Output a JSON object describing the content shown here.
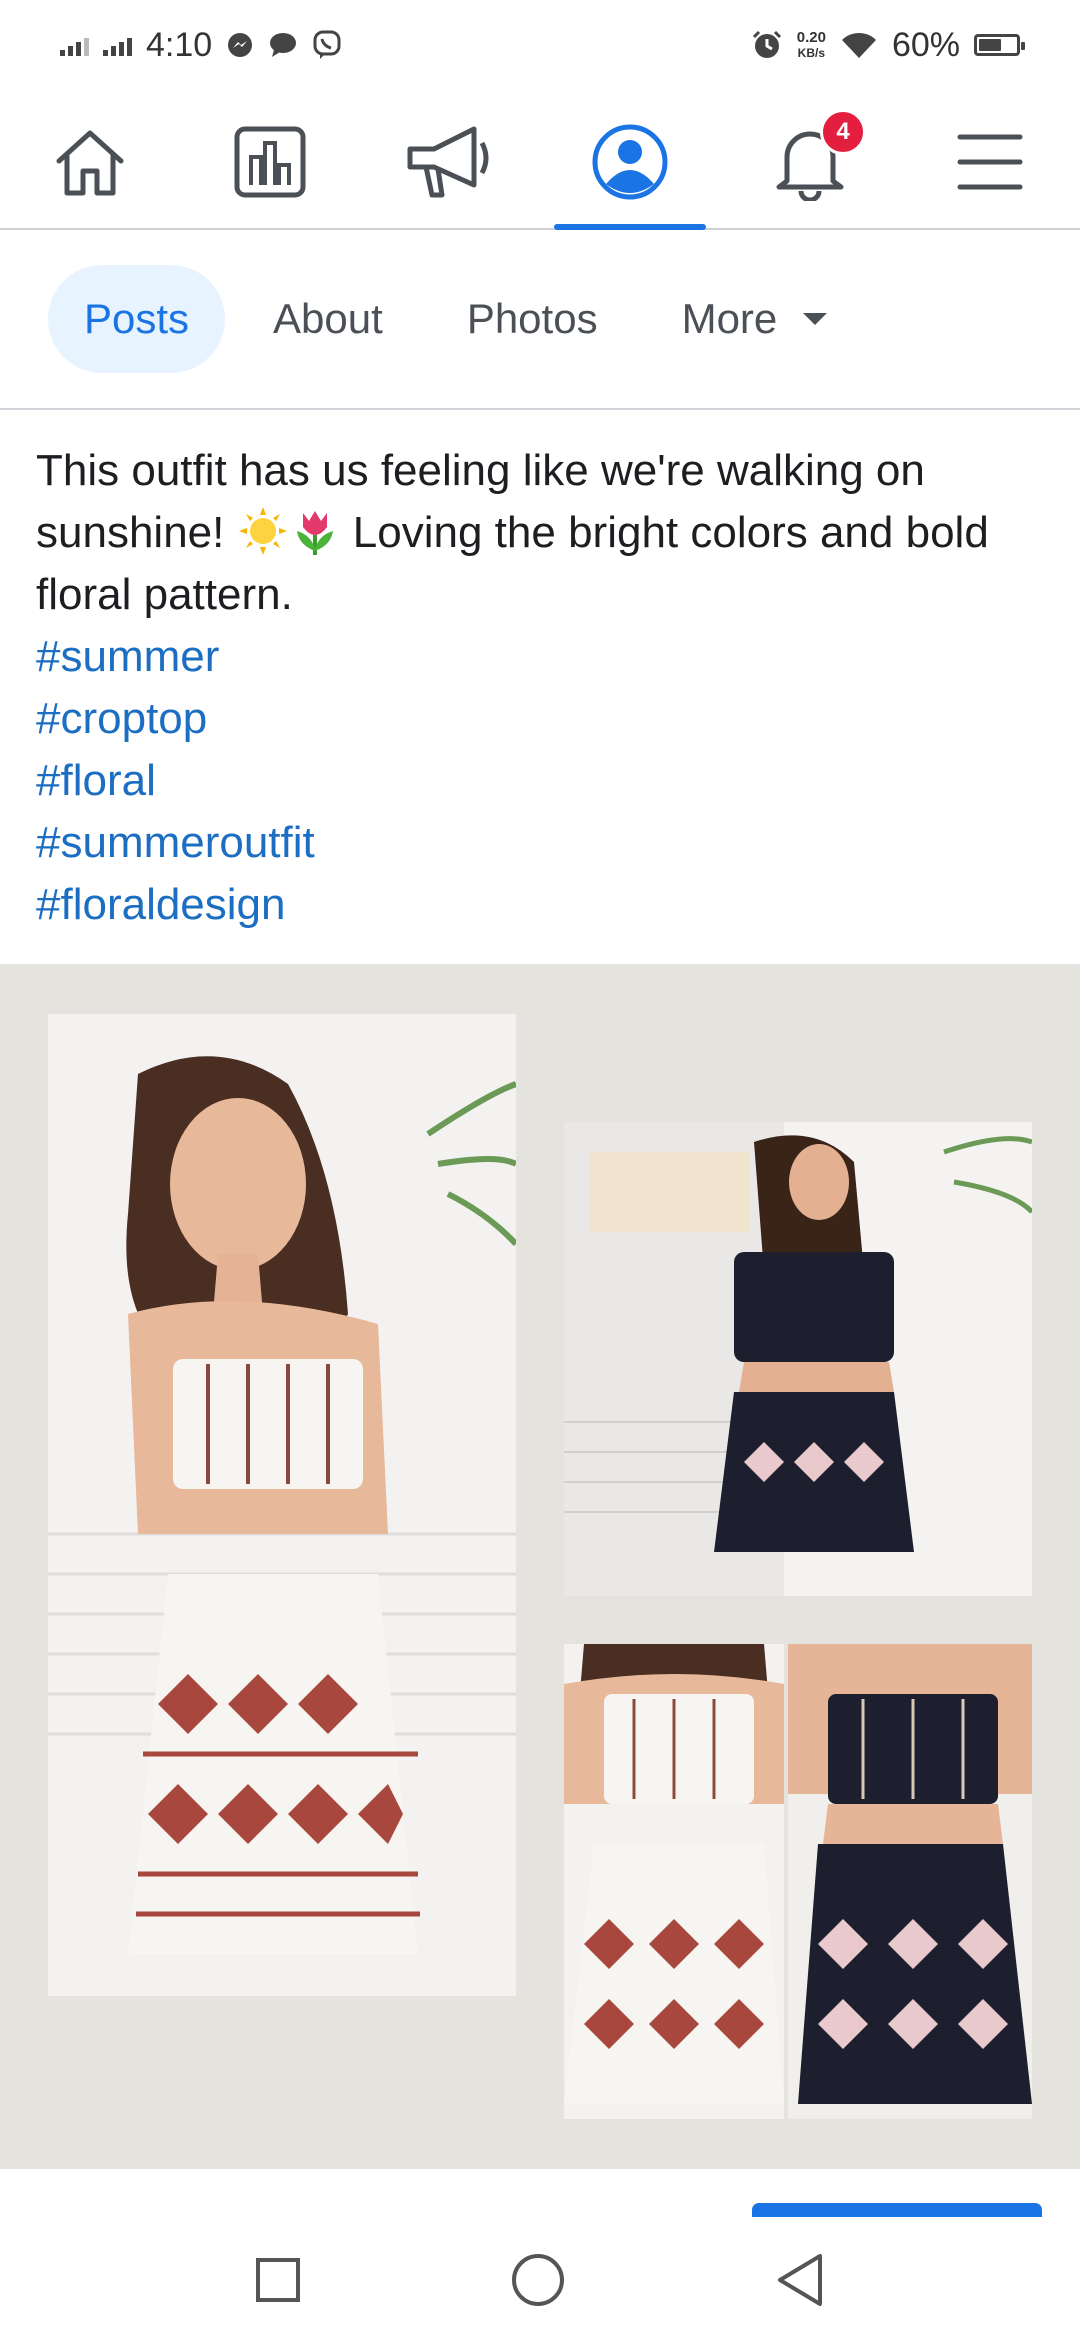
{
  "status_bar": {
    "time": "4:10",
    "net_speed_value": "0.20",
    "net_speed_unit": "KB/s",
    "battery_text": "60%",
    "battery_level": 0.6
  },
  "nav": {
    "items": [
      {
        "icon": "home-icon"
      },
      {
        "icon": "pages-icon"
      },
      {
        "icon": "megaphone-icon"
      },
      {
        "icon": "profile-icon",
        "active": true
      },
      {
        "icon": "bell-icon",
        "badge": "4"
      },
      {
        "icon": "menu-icon"
      }
    ]
  },
  "tabs": {
    "posts": "Posts",
    "about": "About",
    "photos": "Photos",
    "more": "More"
  },
  "post": {
    "text_part1": "This outfit has us feeling like we're walking on sunshine! ",
    "text_part2": " Loving the bright colors and bold floral pattern.",
    "hashtags": [
      "#summer",
      "#croptop",
      "#floral",
      "#summeroutfit",
      "#floraldesign"
    ]
  },
  "colors": {
    "accent": "#1b74e4",
    "hashtag": "#1b6ec2",
    "badge": "#e41e3f",
    "media_bg": "#e4e3dd"
  }
}
